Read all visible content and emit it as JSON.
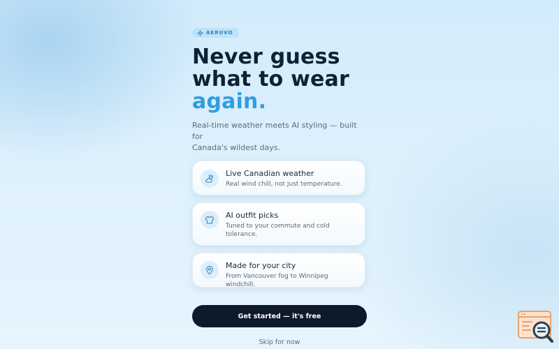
{
  "brand": {
    "name": "AERUVO",
    "icon": "sparkle-icon"
  },
  "hero": {
    "line1": "Never guess",
    "line2": "what to wear",
    "accent": "again."
  },
  "subtitle": {
    "line1": "Real-time weather meets AI styling — built for",
    "line2": "Canada's wildest days."
  },
  "features": [
    {
      "icon": "weather-sun-cloud-icon",
      "title": "Live Canadian weather",
      "desc": "Real wind chill, not just temperature."
    },
    {
      "icon": "shirt-icon",
      "title": "AI outfit picks",
      "desc": "Tuned to your commute and cold tolerance."
    },
    {
      "icon": "location-pin-icon",
      "title": "Made for your city",
      "desc": "From Vancouver fog to Winnipeg windchill."
    }
  ],
  "cta": {
    "label": "Get started — it's free"
  },
  "skip": {
    "label": "Skip for now"
  },
  "colors": {
    "accent": "#2f9ee0",
    "headline": "#0f2235",
    "button_bg": "#0c1a2b",
    "background": "#d7edfb"
  }
}
